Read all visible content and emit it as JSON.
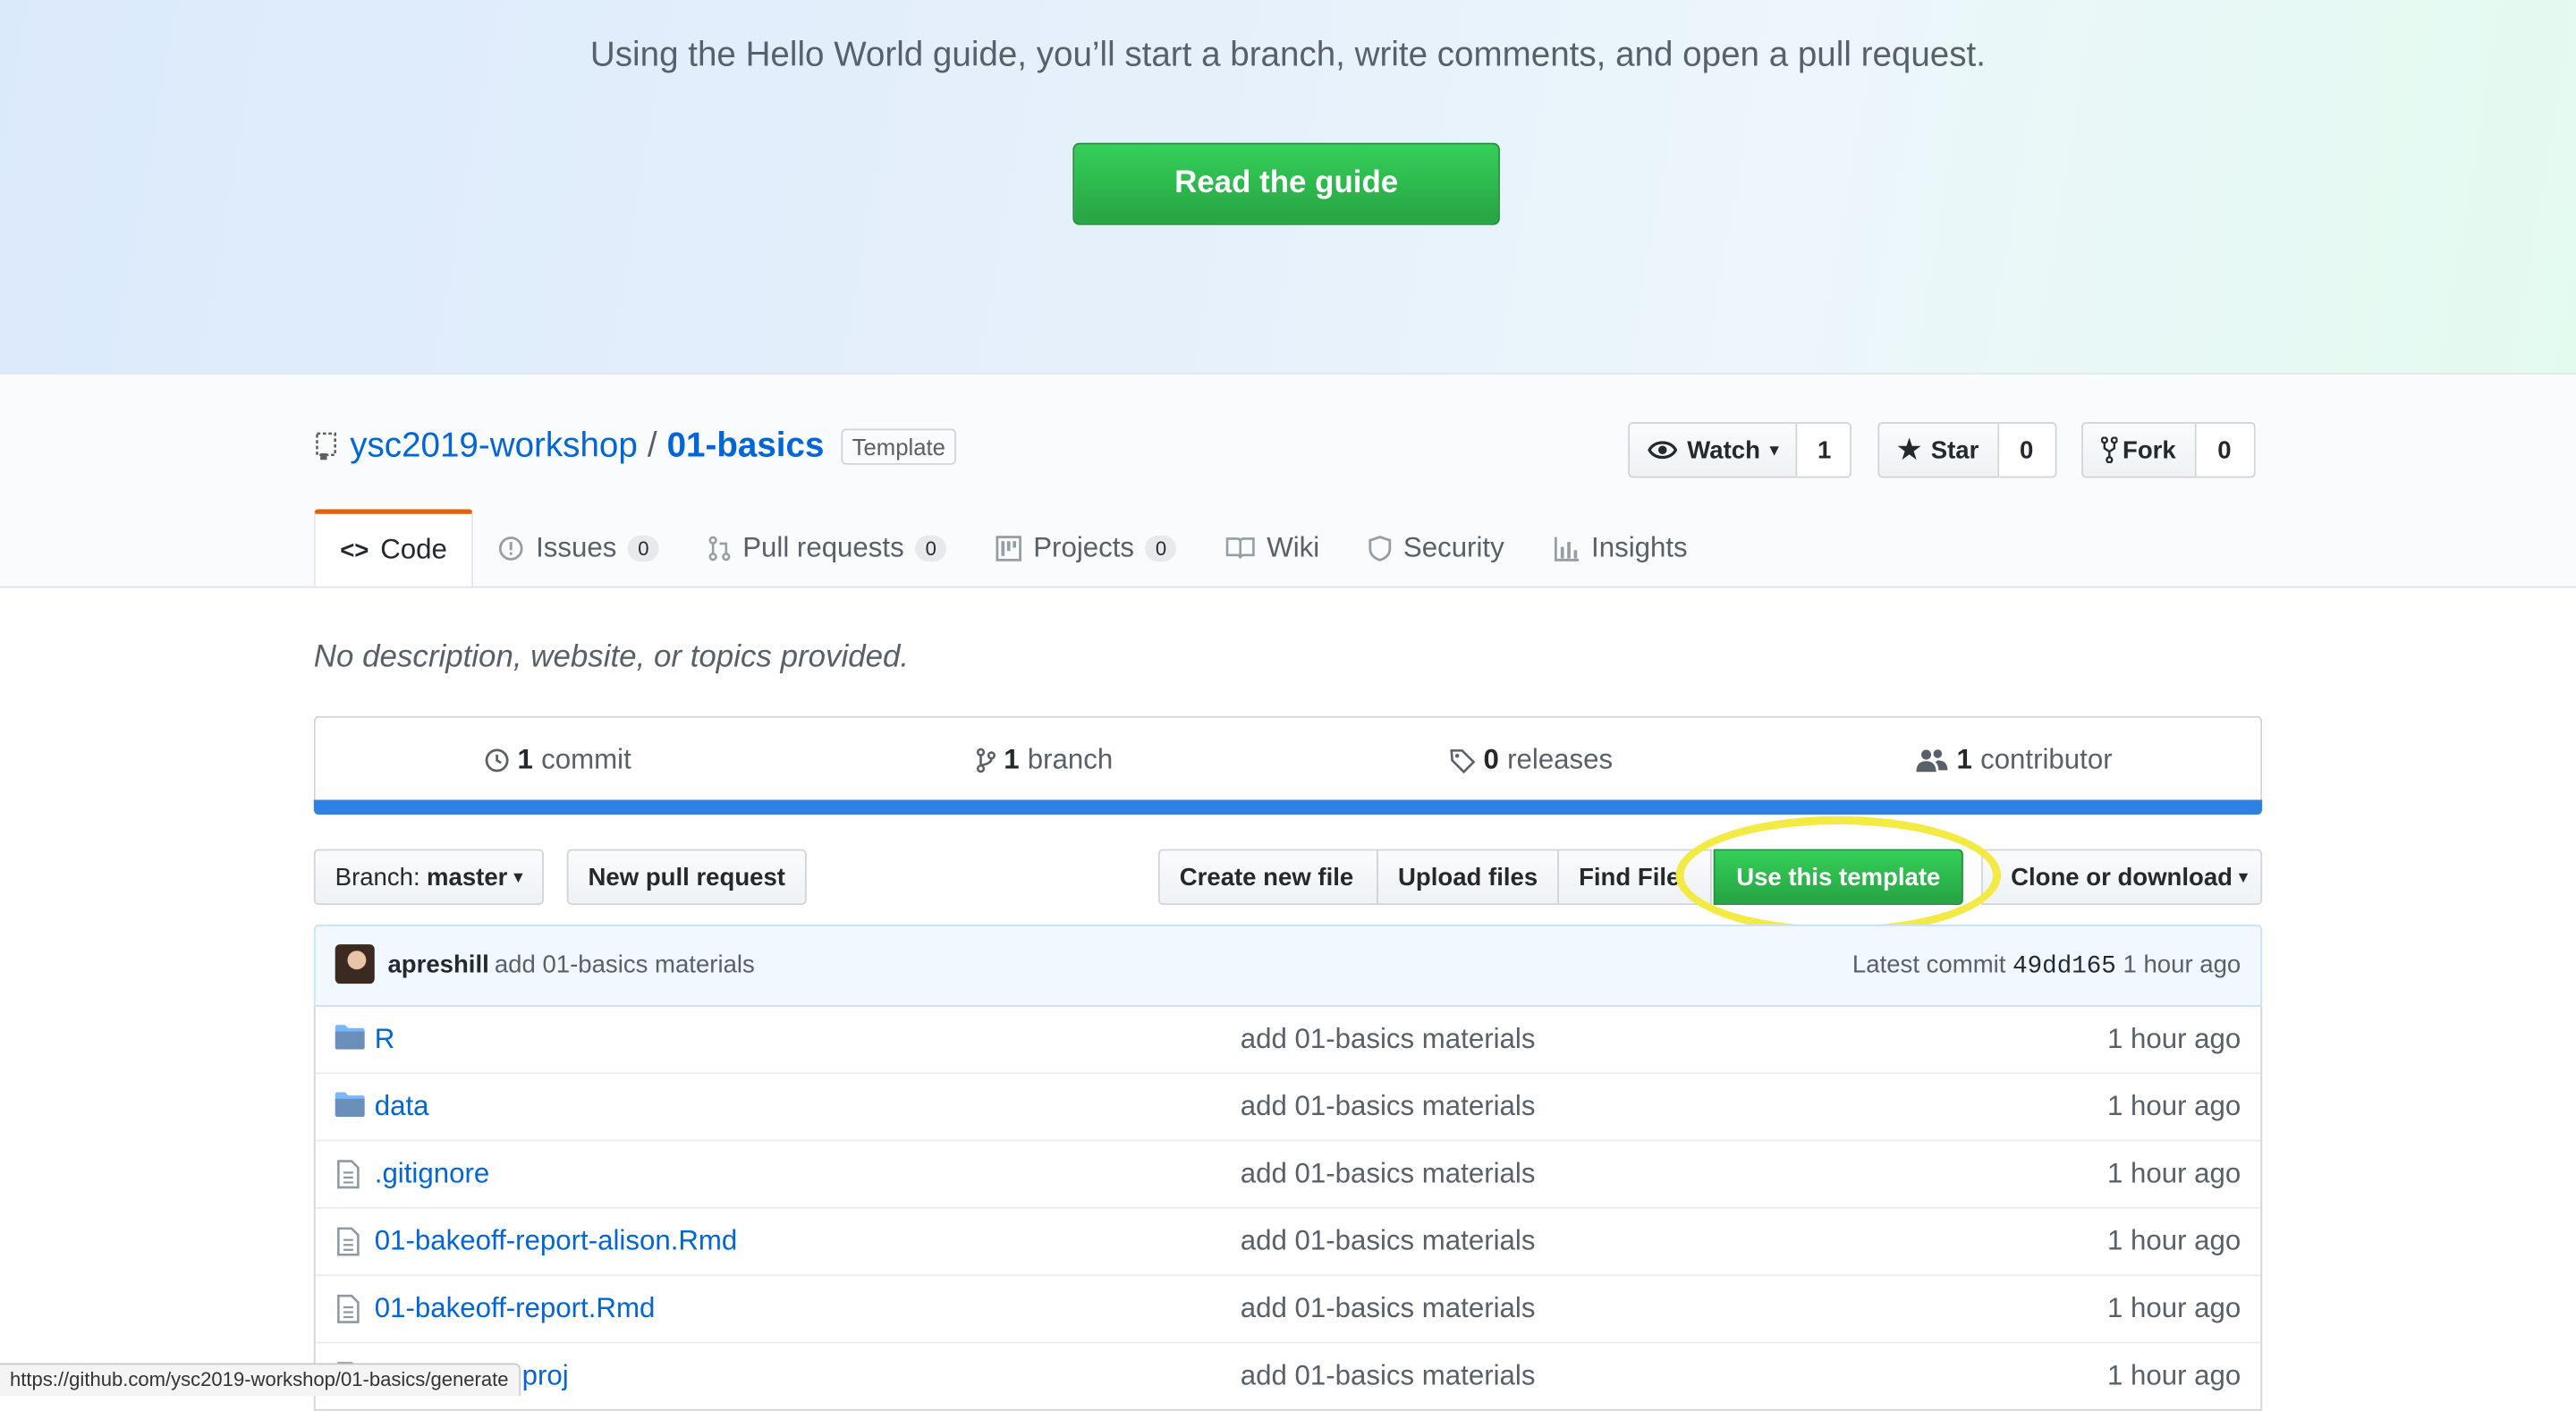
{
  "hero": {
    "text": "Using the Hello World guide, you’ll start a branch, write comments, and open a pull request.",
    "button": "Read the guide"
  },
  "repo": {
    "owner": "ysc2019-workshop",
    "separator": "/",
    "name": "01-basics",
    "label": "Template",
    "description": "No description, website, or topics provided."
  },
  "actions": {
    "watch": {
      "label": "Watch",
      "count": "1"
    },
    "star": {
      "label": "Star",
      "count": "0"
    },
    "fork": {
      "label": "Fork",
      "count": "0"
    }
  },
  "tabs": [
    {
      "label": "Code",
      "icon": "code-icon",
      "selected": true
    },
    {
      "label": "Issues",
      "count": "0",
      "icon": "issue-icon"
    },
    {
      "label": "Pull requests",
      "count": "0",
      "icon": "pull-request-icon"
    },
    {
      "label": "Projects",
      "count": "0",
      "icon": "project-icon"
    },
    {
      "label": "Wiki",
      "icon": "book-icon"
    },
    {
      "label": "Security",
      "icon": "shield-icon"
    },
    {
      "label": "Insights",
      "icon": "graph-icon"
    }
  ],
  "summary": {
    "commits": {
      "num": "1",
      "label": "commit"
    },
    "branches": {
      "num": "1",
      "label": "branch"
    },
    "releases": {
      "num": "0",
      "label": "releases"
    },
    "contributors": {
      "num": "1",
      "label": "contributor"
    }
  },
  "filebar": {
    "branch_prefix": "Branch:",
    "branch": "master",
    "new_pr": "New pull request",
    "create_file": "Create new file",
    "upload": "Upload files",
    "find_file": "Find File",
    "use_template": "Use this template",
    "clone": "Clone or download"
  },
  "commit": {
    "author": "apreshill",
    "message": "add 01-basics materials",
    "latest_label": "Latest commit",
    "sha": "49dd165",
    "age": "1 hour ago"
  },
  "files": [
    {
      "name": "R",
      "type": "dir",
      "message": "add 01-basics materials",
      "age": "1 hour ago"
    },
    {
      "name": "data",
      "type": "dir",
      "message": "add 01-basics materials",
      "age": "1 hour ago"
    },
    {
      "name": ".gitignore",
      "type": "file",
      "message": "add 01-basics materials",
      "age": "1 hour ago"
    },
    {
      "name": "01-bakeoff-report-alison.Rmd",
      "type": "file",
      "message": "add 01-basics materials",
      "age": "1 hour ago"
    },
    {
      "name": "01-bakeoff-report.Rmd",
      "type": "file",
      "message": "add 01-basics materials",
      "age": "1 hour ago"
    },
    {
      "name": "01-basics.Rproj",
      "type": "file",
      "message": "add 01-basics materials",
      "age": "1 hour ago"
    }
  ],
  "status_url": "https://github.com/ysc2019-workshop/01-basics/generate",
  "colors": {
    "green": "#28a745",
    "link": "#0366d6",
    "tab_accent": "#e36209",
    "highlight": "#f4ea46"
  }
}
